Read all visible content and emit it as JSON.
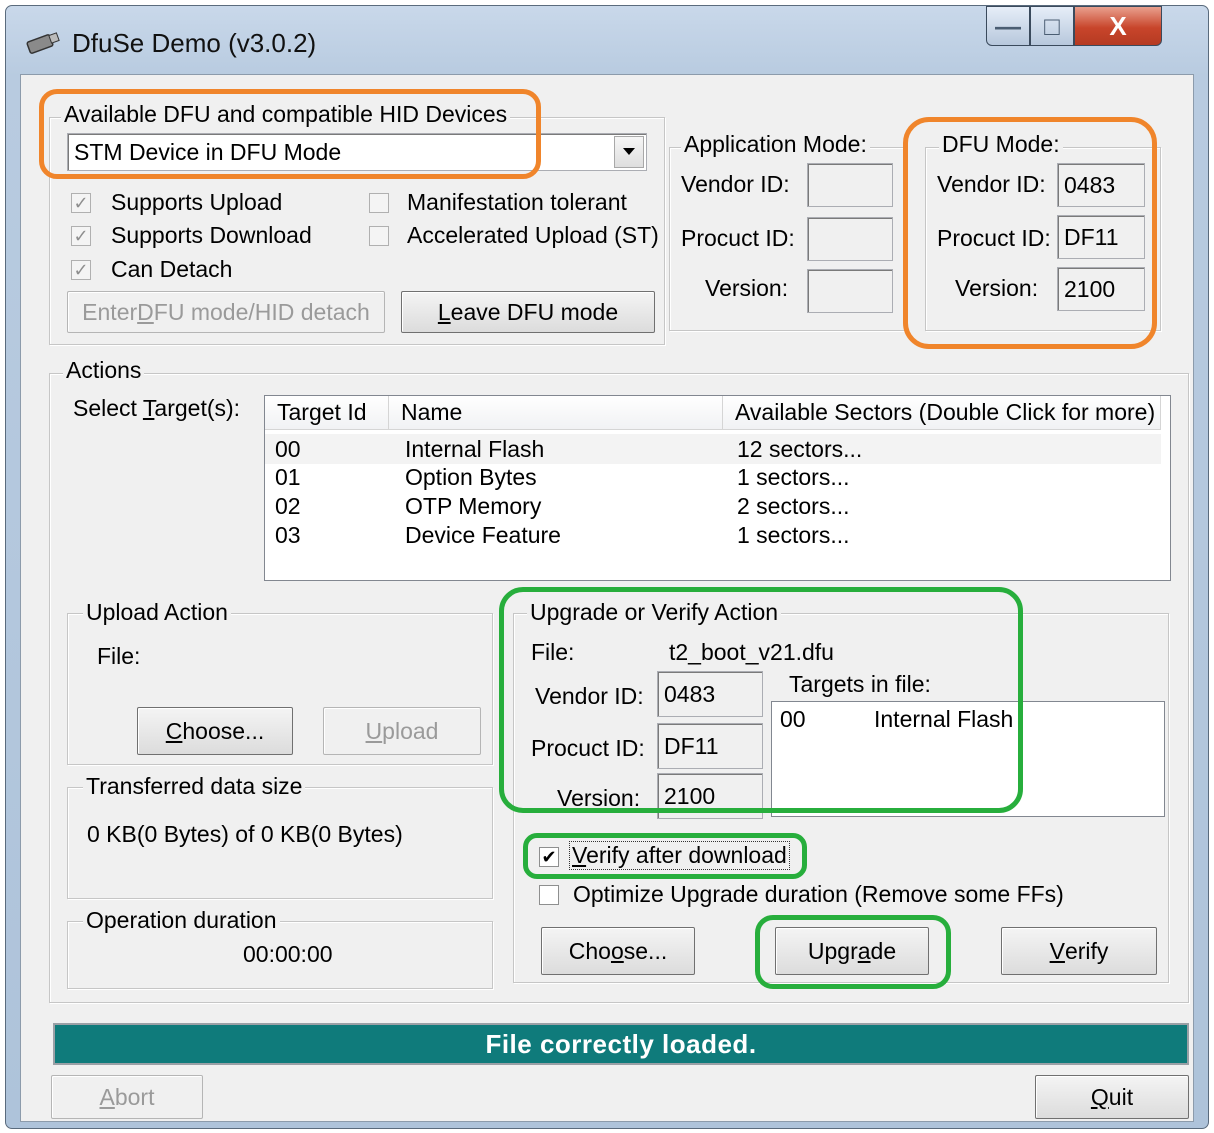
{
  "window": {
    "title": "DfuSe Demo (v3.0.2)",
    "minimize_glyph": "—",
    "maximize_glyph": "□",
    "close_glyph": "X"
  },
  "devices": {
    "group_label": "Available DFU and compatible HID Devices",
    "selected_device": "STM Device in DFU Mode",
    "checkboxes": [
      {
        "label": "Supports Upload",
        "checked": true
      },
      {
        "label": "Supports Download",
        "checked": true
      },
      {
        "label": "Can Detach",
        "checked": true
      },
      {
        "label": "Manifestation tolerant",
        "checked": false
      },
      {
        "label": "Accelerated Upload (ST)",
        "checked": false
      }
    ],
    "enter_dfu_pre": "Enter ",
    "enter_dfu_key": "D",
    "enter_dfu_post": "FU mode/HID detach",
    "leave_dfu_key": "L",
    "leave_dfu_post": "eave DFU mode"
  },
  "app_mode": {
    "label": "Application Mode:",
    "vendor_label": "Vendor ID:",
    "product_label": "Procuct ID:",
    "version_label": "Version:",
    "vendor_value": "",
    "product_value": "",
    "version_value": ""
  },
  "dfu_mode": {
    "label": "DFU Mode:",
    "vendor_label": "Vendor ID:",
    "product_label": "Procuct ID:",
    "version_label": "Version:",
    "vendor_value": "0483",
    "product_value": "DF11",
    "version_value": "2100"
  },
  "actions": {
    "group_label": "Actions",
    "select_target_pre": "Select ",
    "select_target_key": "T",
    "select_target_post": "arget(s):",
    "columns": [
      "Target Id",
      "Name",
      "Available Sectors (Double Click for more)"
    ],
    "rows": [
      {
        "id": "00",
        "name": "Internal Flash",
        "sectors": "12 sectors..."
      },
      {
        "id": "01",
        "name": "Option Bytes",
        "sectors": "1 sectors..."
      },
      {
        "id": "02",
        "name": "OTP Memory",
        "sectors": "2 sectors..."
      },
      {
        "id": "03",
        "name": "Device Feature",
        "sectors": "1 sectors..."
      }
    ]
  },
  "upload": {
    "group_label": "Upload Action",
    "file_label": "File:",
    "choose_key": "C",
    "choose_post": "hoose...",
    "upload_key": "U",
    "upload_post": "pload"
  },
  "transferred": {
    "group_label": "Transferred data size",
    "text": "0 KB(0 Bytes) of 0 KB(0 Bytes)"
  },
  "duration": {
    "group_label": "Operation duration",
    "value": "00:00:00"
  },
  "upgrade": {
    "group_label": "Upgrade or Verify Action",
    "file_label": "File:",
    "file_value": "t2_boot_v21.dfu",
    "vendor_label": "Vendor ID:",
    "vendor_value": "0483",
    "product_label": "Procuct ID:",
    "product_value": "DF11",
    "version_label": "Version:",
    "version_value": "2100",
    "targets_label": "Targets in file:",
    "targets": [
      {
        "id": "00",
        "name": "Internal Flash"
      }
    ],
    "verify_after_pre": "",
    "verify_after_key": "V",
    "verify_after_post": "erify after download",
    "verify_after_checked": true,
    "optimize_label": "Optimize Upgrade duration (Remove some FFs)",
    "optimize_checked": false,
    "choose_pre": "Cho",
    "choose_key": "o",
    "choose_post": "se...",
    "upgrade_pre": "Upgr",
    "upgrade_key": "a",
    "upgrade_post": "de",
    "verify_key": "V",
    "verify_post": "erify"
  },
  "status": {
    "message": "File correctly loaded."
  },
  "bottom": {
    "abort_key": "A",
    "abort_post": "bort",
    "quit_key": "Q",
    "quit_post": "uit"
  },
  "colors": {
    "highlight_orange": "#f0852b",
    "highlight_green": "#27ae3c",
    "status_bar": "#0f7b7b"
  },
  "icons": [
    "app-icon",
    "dropdown-arrow-icon",
    "checkmark-icon"
  ]
}
